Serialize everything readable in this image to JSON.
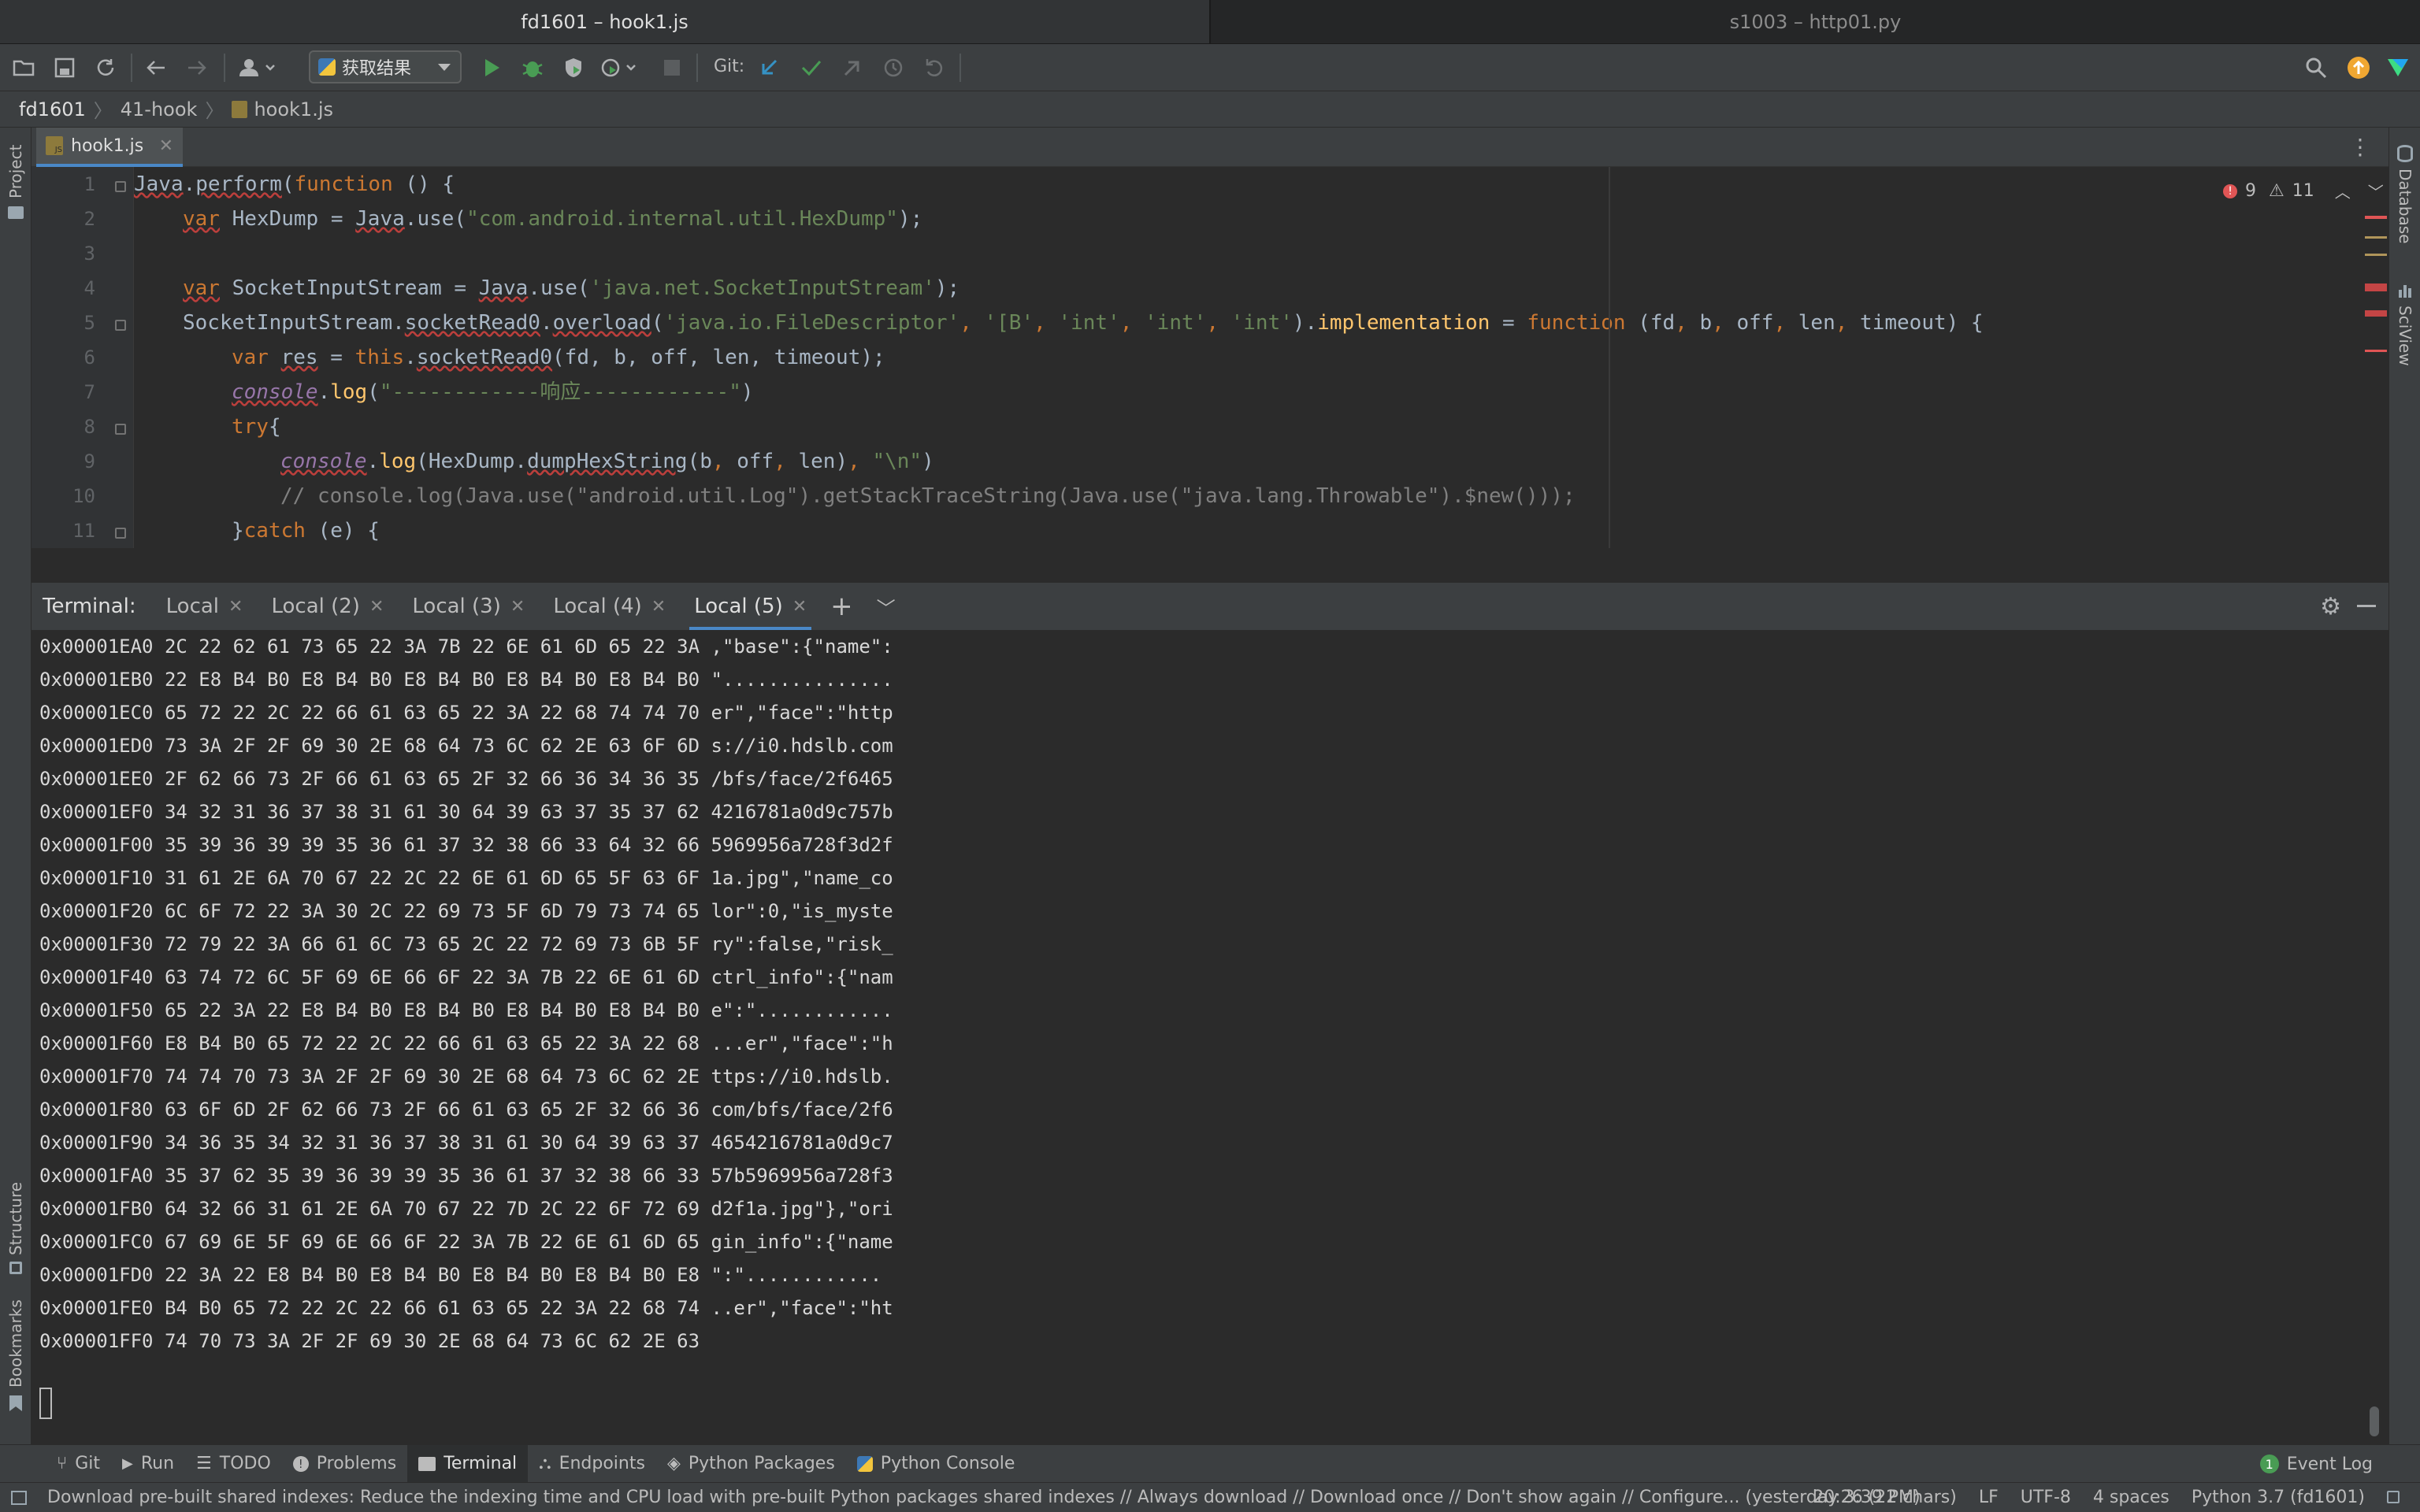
{
  "window_tabs": [
    "fd1601 – hook1.js",
    "s1003 – http01.py"
  ],
  "toolbar": {
    "run_config": "获取结果",
    "git_label": "Git:"
  },
  "breadcrumb": [
    "fd1601",
    "41-hook",
    "hook1.js"
  ],
  "editor": {
    "tab_label": "hook1.js",
    "errors": "9",
    "warnings": "11",
    "line_numbers": [
      "1",
      "2",
      "3",
      "4",
      "5",
      "6",
      "7",
      "8",
      "9",
      "10",
      "11"
    ]
  },
  "code": {
    "l1": {
      "a": "Java",
      "b": ".",
      "c": "perform",
      "d": "(",
      "e": "function",
      "f": " () {"
    },
    "l2": {
      "a": "var",
      "b": " HexDump = ",
      "c": "Java",
      "d": ".",
      "e": "use",
      "f": "(",
      "g": "\"com.android.internal.util.HexDump\"",
      "h": ");"
    },
    "l4": {
      "a": "var",
      "b": " SocketInputStream = ",
      "c": "Java",
      "d": ".",
      "e": "use",
      "f": "(",
      "g": "'java.net.SocketInputStream'",
      "h": ");"
    },
    "l5": {
      "a": "SocketInputStream.",
      "b": "socketRead0",
      "c": ".",
      "d": "overload",
      "e": "(",
      "f": "'java.io.FileDescriptor'",
      "g": ", ",
      "h": "'[B'",
      "i": ", ",
      "j": "'int'",
      "k": ", ",
      "l": "'int'",
      "m": ", ",
      "n": "'int'",
      "o": ").",
      "p": "implementation",
      "q": " = ",
      "r": "function",
      "s": " (fd",
      "t": ", ",
      "u": "b",
      "v": ", ",
      "w": "off",
      "x": ", ",
      "y": "len",
      "z": ", ",
      "za": "timeout) {"
    },
    "l6": {
      "a": "var",
      "b": " ",
      "c": "res",
      "d": " = ",
      "e": "this",
      "f": ".",
      "g": "socketRead0",
      "h": "(fd, b, off, len, timeout);"
    },
    "l7": {
      "a": "console",
      "b": ".",
      "c": "log",
      "d": "(",
      "e": "\"------------响应------------\"",
      "f": ")"
    },
    "l8": {
      "a": "try",
      "b": "{"
    },
    "l9": {
      "a": "console",
      "b": ".",
      "c": "log",
      "d": "(HexDump.",
      "e": "dumpHexString",
      "f": "(b",
      "g": ", ",
      "h": "off",
      "i": ", ",
      "j": "len)",
      "k": ", ",
      "l": "\"\\n\"",
      "m": ")"
    },
    "l10": "// console.log(Java.use(\"android.util.Log\").getStackTraceString(Java.use(\"java.lang.Throwable\").$new()));",
    "l11": {
      "a": "}",
      "b": "catch",
      "c": " (e) {"
    }
  },
  "terminal": {
    "label": "Terminal:",
    "tabs": [
      "Local",
      "Local (2)",
      "Local (3)",
      "Local (4)",
      "Local (5)"
    ],
    "lines": [
      "0x00001EA0 2C 22 62 61 73 65 22 3A 7B 22 6E 61 6D 65 22 3A ,\"base\":{\"name\":",
      "0x00001EB0 22 E8 B4 B0 E8 B4 B0 E8 B4 B0 E8 B4 B0 E8 B4 B0 \"...............",
      "0x00001EC0 65 72 22 2C 22 66 61 63 65 22 3A 22 68 74 74 70 er\",\"face\":\"http",
      "0x00001ED0 73 3A 2F 2F 69 30 2E 68 64 73 6C 62 2E 63 6F 6D s://i0.hdslb.com",
      "0x00001EE0 2F 62 66 73 2F 66 61 63 65 2F 32 66 36 34 36 35 /bfs/face/2f6465",
      "0x00001EF0 34 32 31 36 37 38 31 61 30 64 39 63 37 35 37 62 4216781a0d9c757b",
      "0x00001F00 35 39 36 39 39 35 36 61 37 32 38 66 33 64 32 66 5969956a728f3d2f",
      "0x00001F10 31 61 2E 6A 70 67 22 2C 22 6E 61 6D 65 5F 63 6F 1a.jpg\",\"name_co",
      "0x00001F20 6C 6F 72 22 3A 30 2C 22 69 73 5F 6D 79 73 74 65 lor\":0,\"is_myste",
      "0x00001F30 72 79 22 3A 66 61 6C 73 65 2C 22 72 69 73 6B 5F ry\":false,\"risk_",
      "0x00001F40 63 74 72 6C 5F 69 6E 66 6F 22 3A 7B 22 6E 61 6D ctrl_info\":{\"nam",
      "0x00001F50 65 22 3A 22 E8 B4 B0 E8 B4 B0 E8 B4 B0 E8 B4 B0 e\":\"............",
      "0x00001F60 E8 B4 B0 65 72 22 2C 22 66 61 63 65 22 3A 22 68 ...er\",\"face\":\"h",
      "0x00001F70 74 74 70 73 3A 2F 2F 69 30 2E 68 64 73 6C 62 2E ttps://i0.hdslb.",
      "0x00001F80 63 6F 6D 2F 62 66 73 2F 66 61 63 65 2F 32 66 36 com/bfs/face/2f6",
      "0x00001F90 34 36 35 34 32 31 36 37 38 31 61 30 64 39 63 37 4654216781a0d9c7",
      "0x00001FA0 35 37 62 35 39 36 39 39 35 36 61 37 32 38 66 33 57b5969956a728f3",
      "0x00001FB0 64 32 66 31 61 2E 6A 70 67 22 7D 2C 22 6F 72 69 d2f1a.jpg\"},\"ori",
      "0x00001FC0 67 69 6E 5F 69 6E 66 6F 22 3A 7B 22 6E 61 6D 65 gin_info\":{\"name",
      "0x00001FD0 22 3A 22 E8 B4 B0 E8 B4 B0 E8 B4 B0 E8 B4 B0 E8 \":\"............",
      "0x00001FE0 B4 B0 65 72 22 2C 22 66 61 63 65 22 3A 22 68 74 ..er\",\"face\":\"ht",
      "0x00001FF0 74 70 73 3A 2F 2F 69 30 2E 68 64 73 6C 62 2E 63"
    ]
  },
  "side": {
    "project": "Project",
    "structure": "Structure",
    "bookmarks": "Bookmarks",
    "database": "Database",
    "sciview": "SciView"
  },
  "toolwindows": [
    "Git",
    "Run",
    "TODO",
    "Problems",
    "Terminal",
    "Endpoints",
    "Python Packages",
    "Python Console"
  ],
  "event_log": {
    "count": "1",
    "label": "Event Log"
  },
  "status": {
    "message": "Download pre-built shared indexes: Reduce the indexing time and CPU load with pre-built Python packages shared indexes // Always download // Download once // Don't show again // Configure... (yesterday 3:39 PM)",
    "position": "20:26 (22 chars)",
    "line_sep": "LF",
    "encoding": "UTF-8",
    "indent": "4 spaces",
    "interpreter": "Python 3.7 (fd1601)"
  },
  "colors": {
    "accent": "#4a88c7",
    "run_green": "#499c54",
    "error_red": "#e05555",
    "warn_orange": "#f0a732"
  }
}
